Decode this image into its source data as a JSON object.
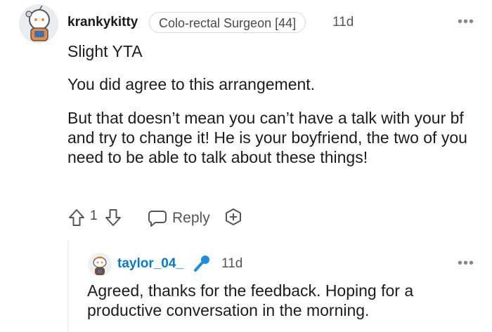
{
  "comment": {
    "username": "krankykitty",
    "flair": "Colo-rectal Surgeon [44]",
    "time": "11d",
    "more_label": "•••",
    "paragraphs": [
      "Slight YTA",
      "You did agree to this arrangement.",
      "But that doesn’t mean you can’t have a talk with your bf and try to change it! He is your boyfriend, the two of you need to be able to talk about these things!"
    ],
    "vote_count": "1",
    "reply_label": "Reply",
    "icons": {
      "upvote": "arrow-up-icon",
      "downvote": "arrow-down-icon",
      "reply": "speech-bubble-icon",
      "award": "add-award-icon"
    }
  },
  "reply": {
    "username": "taylor_04_",
    "time": "11d",
    "more_label": "•••",
    "text": "Agreed, thanks for the feedback. Hoping for a productive conversation in the morning.",
    "badge_icon": "microphone-icon"
  },
  "colors": {
    "reply_username": "#0a7ac7",
    "badge": "#1a8ee0",
    "avatar_orange": "#e8893b",
    "text": "#1c1c1c"
  }
}
